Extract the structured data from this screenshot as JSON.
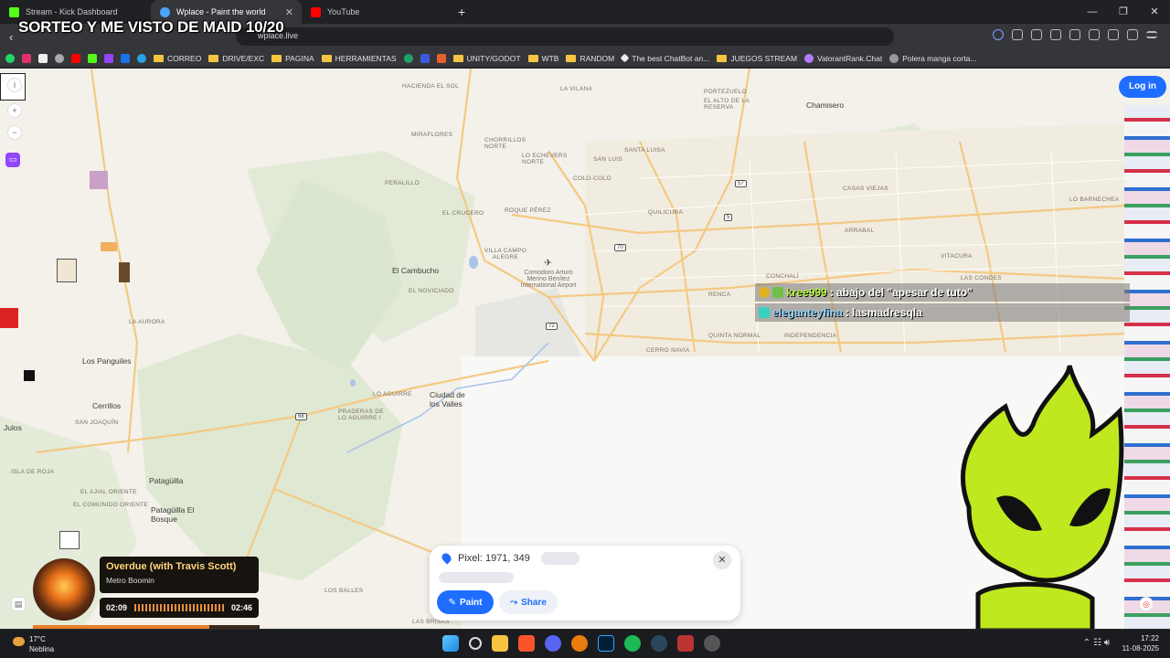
{
  "overlay": {
    "title": "SORTEO Y ME VISTO DE MAID 10/20"
  },
  "tabs": [
    {
      "label": "Stream - Kick Dashboard",
      "color": "#53fc18"
    },
    {
      "label": "Wplace - Paint the world",
      "color": "#4aa3ff"
    },
    {
      "label": "YouTube",
      "color": "#ff0000"
    }
  ],
  "address": {
    "url": "wplace.live"
  },
  "bookmarks": [
    "CORREO",
    "DRIVE/EXC",
    "PAGINA",
    "HERRAMIENTAS",
    "UNITY/GODOT",
    "WTB",
    "RANDOM",
    "The best ChatBot an...",
    "JUEGOS STREAM",
    "ValorantRank.Chat",
    "Polera manga corta..."
  ],
  "map": {
    "places": [
      "HACIENDA EL SOL",
      "LA VILANA",
      "PORTEZUELO",
      "EL ALTO DE LA RESERVA",
      "Chamisero",
      "MIRAFLORES",
      "CHORRILLOS NORTE",
      "SANTA LUISA",
      "SAN LUIS",
      "LO ECHEVERS NORTE",
      "COLO-COLO",
      "PERALILLO",
      "EL CRUCERO",
      "ROQUE PÉREZ",
      "QUILICURA",
      "CASAS VIEJAS",
      "LO BARNECHEA",
      "VILLA CAMPO ALEGRE",
      "El Cambucho",
      "Comodoro Arturo Merino Benítez International Airport",
      "LA AURORA",
      "ARRABAL",
      "VITACURA",
      "EL NOVICIADO",
      "CONCHALÍ",
      "RENCA",
      "LAS CONDES",
      "QUINTA NORMAL",
      "INDEPENDENCIA",
      "CERRO NAVIA",
      "Los Panguiles",
      "Cerrillos",
      "SAN JOAQUÍN",
      "LO AGUIRRE",
      "PRADERAS DE LO AGUIRRE I",
      "Ciudad de los Valles",
      "Julos",
      "ISLA DE ROJA",
      "EL AJIAL ORIENTE",
      "EL COMUNIDO ORIENTE",
      "Patagüilla",
      "Patagüilla El Bosque",
      "LAS BRISAS",
      "LOS BALLES"
    ],
    "routes": [
      "57",
      "5",
      "70",
      "72",
      "68"
    ]
  },
  "login": {
    "label": "Log in"
  },
  "chat": [
    {
      "user": "kree999",
      "message": ": abajo del \"apesar de tuto\"",
      "color": "#b5f542"
    },
    {
      "user": "eleganteyfina",
      "message": ": lasmadresqla",
      "color": "#8fd4ff"
    }
  ],
  "pixel_panel": {
    "coords": "Pixel: 1971, 349",
    "paint": "Paint",
    "share": "Share"
  },
  "now_playing": {
    "title": "Overdue (with Travis Scott)",
    "artist": "Metro Boomin",
    "elapsed": "02:09",
    "total": "02:46",
    "progress": 0.78
  },
  "taskbar": {
    "temp": "17°C",
    "weather": "Neblina",
    "time": "17:22",
    "date": "11-08-2025"
  }
}
